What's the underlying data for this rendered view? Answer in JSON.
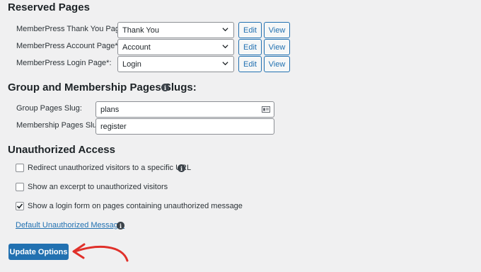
{
  "reserved_pages": {
    "heading": "Reserved Pages",
    "rows": [
      {
        "label": "MemberPress Thank You Page*:",
        "value": "Thank You",
        "edit": "Edit",
        "view": "View"
      },
      {
        "label": "MemberPress Account Page*:",
        "value": "Account",
        "edit": "Edit",
        "view": "View"
      },
      {
        "label": "MemberPress Login Page*:",
        "value": "Login",
        "edit": "Edit",
        "view": "View"
      }
    ]
  },
  "slugs": {
    "heading": "Group and Membership Pages Slugs:",
    "group_label": "Group Pages Slug:",
    "group_value": "plans",
    "membership_label": "Membership Pages Slug:",
    "membership_value": "register"
  },
  "unauthorized": {
    "heading": "Unauthorized Access",
    "options": [
      {
        "label": "Redirect unauthorized visitors to a specific URL",
        "checked": false
      },
      {
        "label": "Show an excerpt to unauthorized visitors",
        "checked": false
      },
      {
        "label": "Show a login form on pages containing unauthorized message",
        "checked": true
      }
    ],
    "default_message_link": "Default Unauthorized Message:"
  },
  "submit_label": "Update Options",
  "colors": {
    "accent": "#2271b1",
    "annotation_arrow": "#e0302a"
  },
  "icons": {
    "info": "info-icon",
    "select_arrow": "chevron-down-icon",
    "field_card": "contact-card-icon",
    "checkmark": "checkmark-icon"
  }
}
